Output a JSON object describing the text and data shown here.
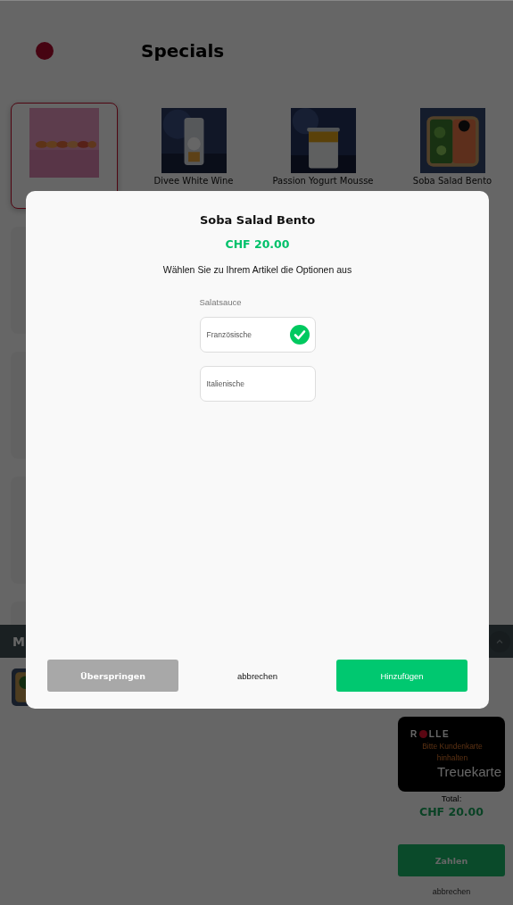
{
  "header": {
    "title": "Specials"
  },
  "products": [
    {
      "selected": true
    },
    {
      "name": "Divee White Wine",
      "selected": false
    },
    {
      "name": "Passion Yogurt Mousse",
      "selected": false
    },
    {
      "name": "Soba Salad Bento",
      "selected": false
    }
  ],
  "order_bar": {
    "title": "M"
  },
  "loyalty_card": {
    "brand_start": "R",
    "brand_end": "LLE",
    "prompt": "Bitte Kundenkarte hinhalten",
    "label": "Treuekarte"
  },
  "total": {
    "label": "Total:",
    "amount": "CHF 20.00"
  },
  "pay_button": "Zahlen",
  "cancel_link": "abbrechen",
  "dialog": {
    "title": "Soba Salad Bento",
    "price": "CHF 20.00",
    "instruction": "Wählen Sie zu Ihrem Artikel die Optionen aus",
    "group_label": "Salatsauce",
    "options": [
      {
        "label": "Französische",
        "selected": true
      },
      {
        "label": "Italienische",
        "selected": false
      }
    ],
    "buttons": [
      {
        "label": "Überspringen",
        "kind": "secondary"
      },
      {
        "label": "abbrechen",
        "kind": "text"
      },
      {
        "label": "Hinzufügen",
        "kind": "primary"
      }
    ]
  }
}
